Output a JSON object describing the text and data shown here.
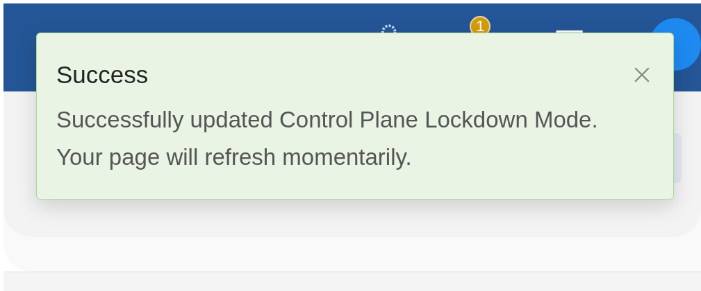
{
  "header": {
    "notification_badge": "1"
  },
  "toast": {
    "title": "Success",
    "message": "Successfully updated Control Plane Lockdown Mode. Your page will refresh momentarily."
  }
}
